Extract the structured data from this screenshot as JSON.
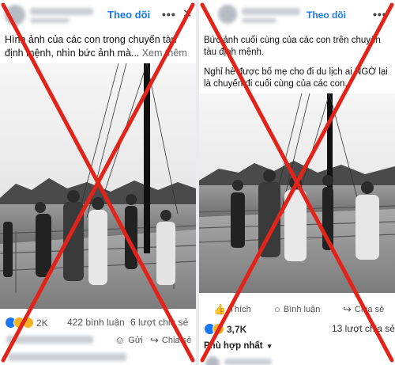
{
  "left_post": {
    "follow_label": "Theo dõi",
    "caption": "Hình ảnh của các con trong chuyến tàu định mệnh, nhìn bức ảnh mà...",
    "see_more": "Xem thêm",
    "reaction_count": "2K",
    "comments": "422 bình luận",
    "shares": "6 lượt chia sẻ",
    "actions": {
      "send": "Gửi",
      "share": "Chia sẻ"
    }
  },
  "right_post": {
    "follow_label": "Theo dõi",
    "caption_1": "Bức ảnh cuối cùng của các con trên chuyến tàu định mệnh.",
    "caption_2": "Nghỉ hè được bố mẹ cho đi du lịch ai NGỜ lại là chuyến đi cuối cùng của các con.",
    "actions": {
      "like": "Thích",
      "comment": "Bình luận",
      "share": "Chia sẻ"
    },
    "reaction_count": "3,7K",
    "shares": "13 lượt chia sẻ",
    "sort_label": "Phù hợp nhất"
  },
  "icons": [
    "more-icon",
    "close-icon",
    "back-icon",
    "like-icon",
    "comment-icon",
    "share-icon",
    "send-icon",
    "chevron-down-icon"
  ],
  "colors": {
    "accent": "#1877f2",
    "cross": "#e2231a",
    "like": "#1877f2",
    "haha": "#f7b125"
  }
}
